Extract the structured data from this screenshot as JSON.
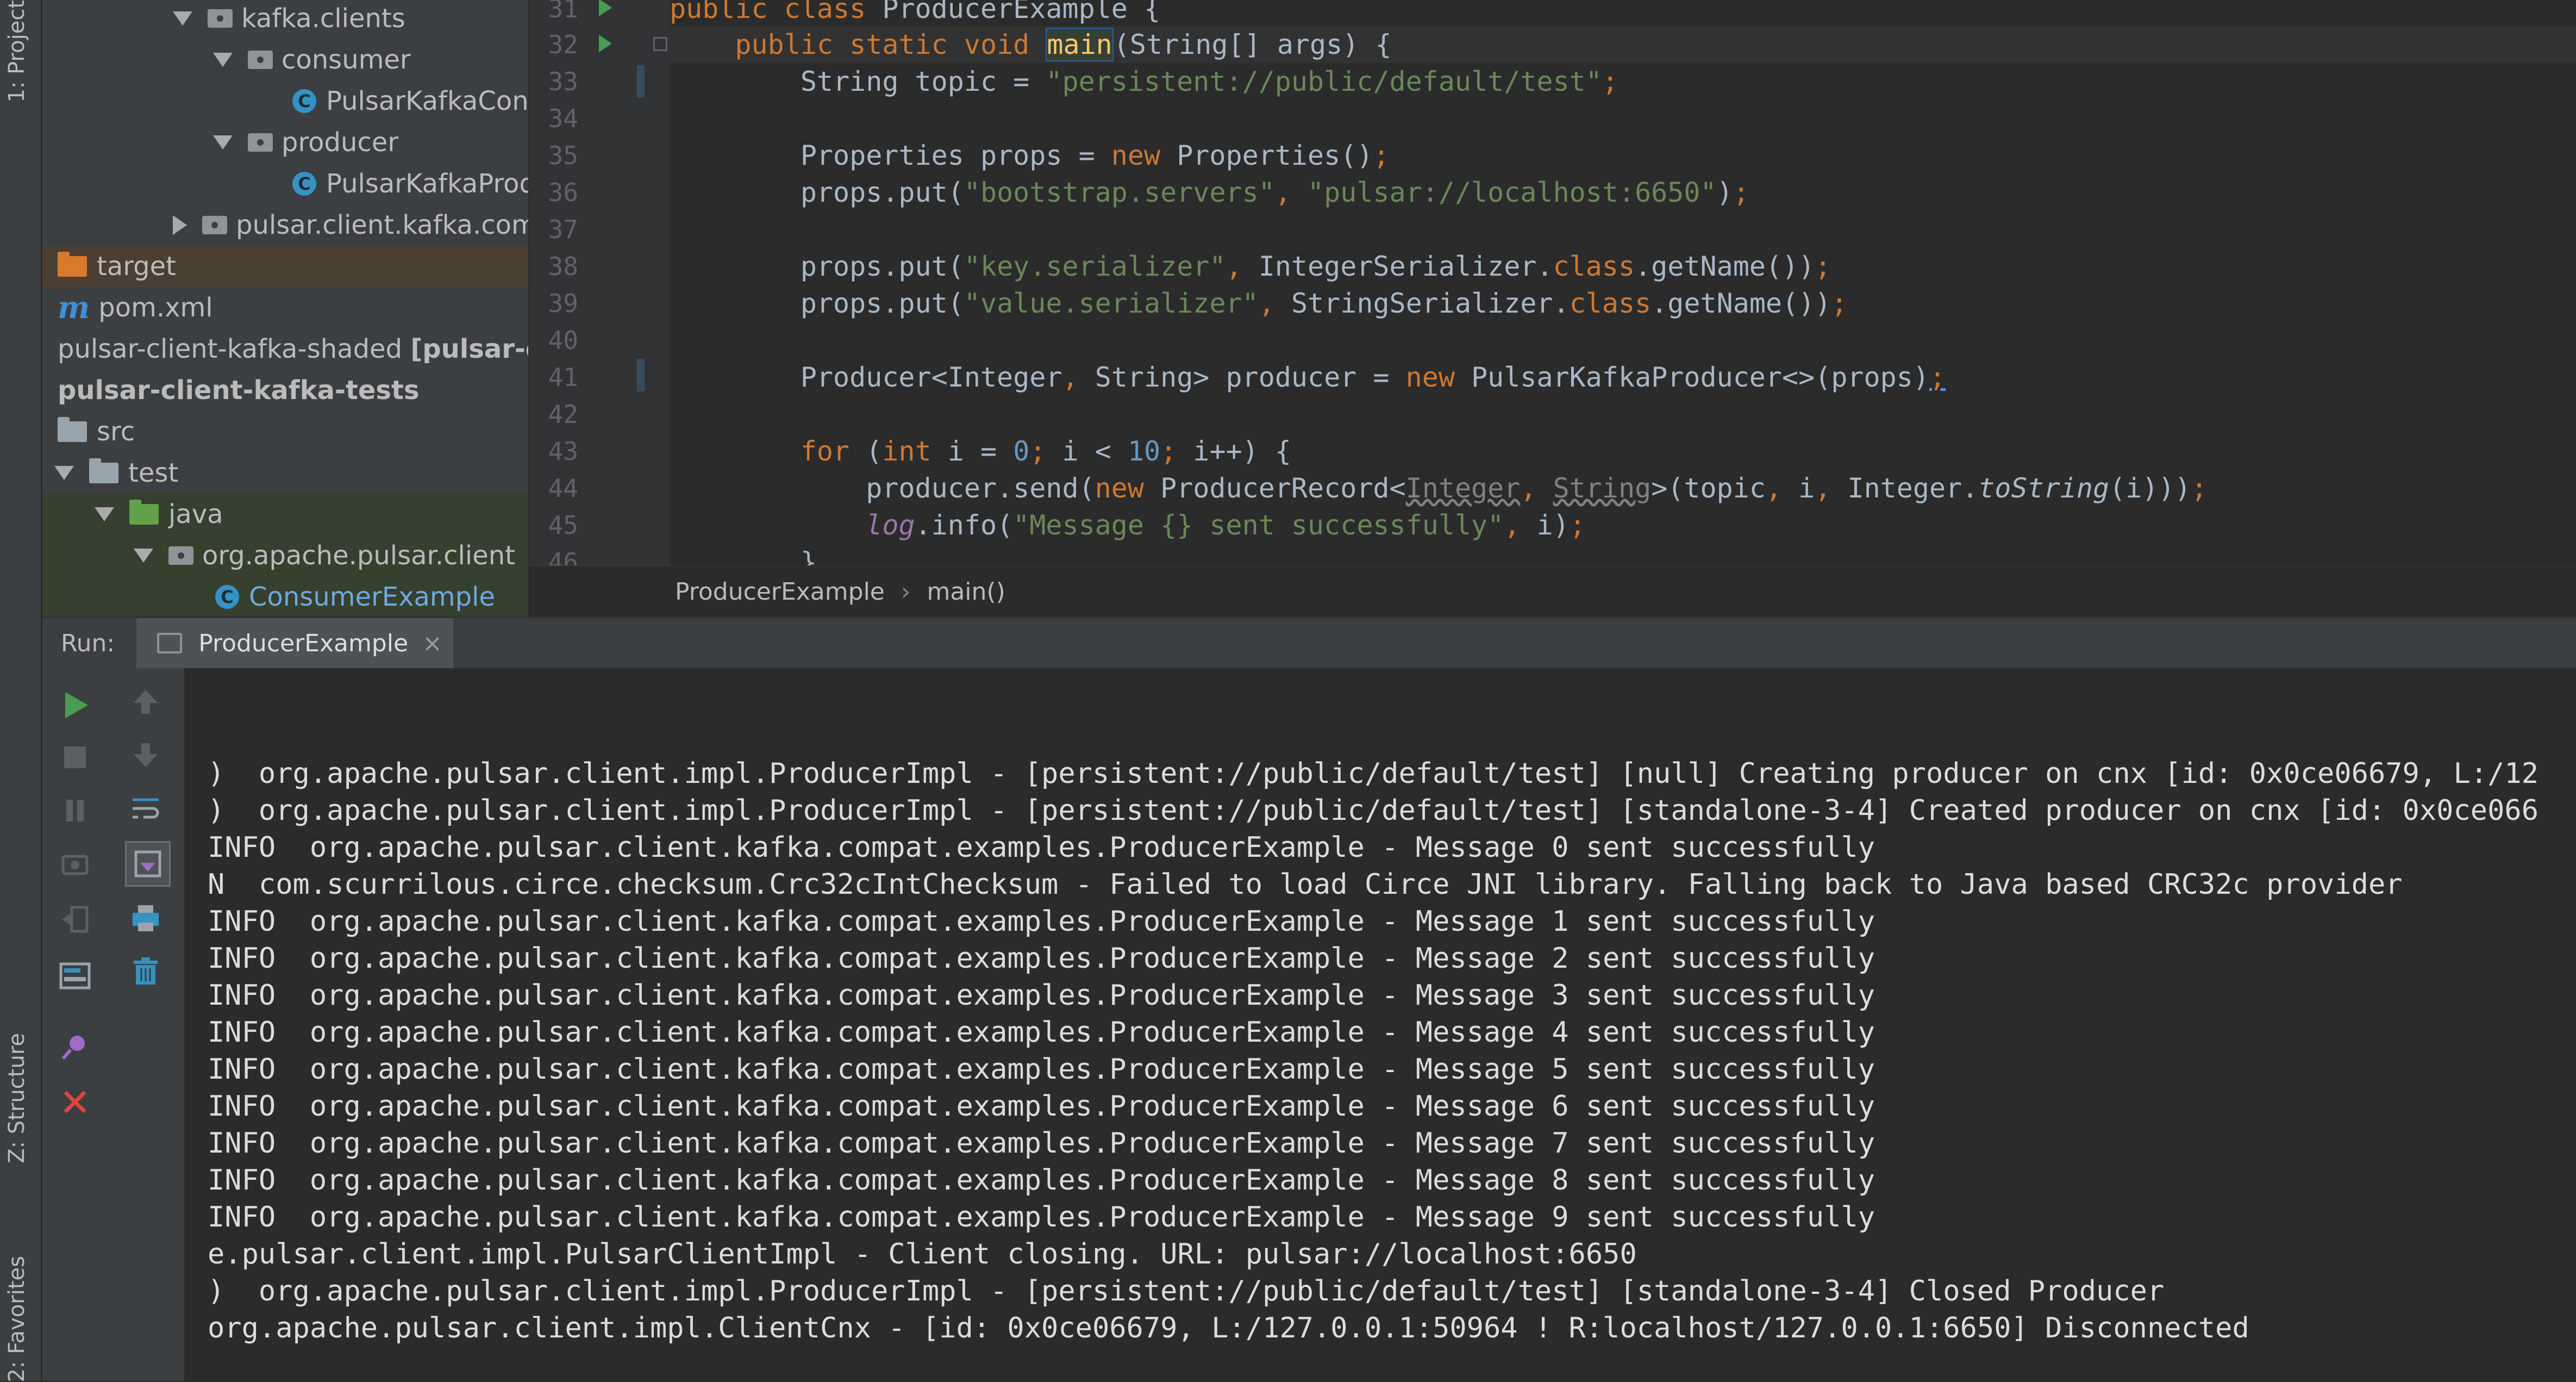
{
  "left_stripe": {
    "project_tab": "1: Project",
    "structure_tab": "Z: Structure",
    "favorites_tab": "2: Favorites"
  },
  "project_tree": {
    "rows": [
      {
        "label": "kafka.clients",
        "icon": "package-icon",
        "expanded": true
      },
      {
        "label": "consumer",
        "icon": "package-icon",
        "expanded": true
      },
      {
        "label": "PulsarKafkaConsumer",
        "icon": "class-icon"
      },
      {
        "label": "producer",
        "icon": "package-icon",
        "expanded": true
      },
      {
        "label": "PulsarKafkaProducer",
        "icon": "class-icon"
      },
      {
        "label": "pulsar.client.kafka.compat",
        "icon": "package-icon",
        "expanded": false
      },
      {
        "label": "target",
        "icon": "folder-orange-icon"
      },
      {
        "label": "pom.xml",
        "icon": "maven-icon"
      },
      {
        "label": "pulsar-client-kafka-shaded",
        "suffix": "[pulsar-client-kafka]",
        "icon": "none"
      },
      {
        "label": "pulsar-client-kafka-tests",
        "icon": "none"
      },
      {
        "label": "src",
        "icon": "folder-icon"
      },
      {
        "label": "test",
        "icon": "folder-icon",
        "expanded": true
      },
      {
        "label": "java",
        "icon": "folder-green-icon",
        "expanded": true
      },
      {
        "label": "org.apache.pulsar.client",
        "icon": "package-icon",
        "expanded": true
      },
      {
        "label": "ConsumerExample",
        "icon": "class-icon"
      }
    ]
  },
  "editor": {
    "line_numbers": [
      "31",
      "32",
      "33",
      "34",
      "35",
      "36",
      "37",
      "38",
      "39",
      "40",
      "41",
      "42",
      "43",
      "44",
      "45",
      "46"
    ],
    "breadcrumb_class": "ProducerExample",
    "breadcrumb_method": "main()",
    "breadcrumb_sep": "›"
  },
  "run_panel": {
    "label": "Run:",
    "tab_title": "ProducerExample",
    "close": "×",
    "log_lines": [
      ")  org.apache.pulsar.client.impl.ProducerImpl - [persistent://public/default/test] [null] Creating producer on cnx [id: 0x0ce06679, L:/12",
      ")  org.apache.pulsar.client.impl.ProducerImpl - [persistent://public/default/test] [standalone-3-4] Created producer on cnx [id: 0x0ce066",
      "INFO  org.apache.pulsar.client.kafka.compat.examples.ProducerExample - Message 0 sent successfully",
      "N  com.scurrilous.circe.checksum.Crc32cIntChecksum - Failed to load Circe JNI library. Falling back to Java based CRC32c provider",
      "INFO  org.apache.pulsar.client.kafka.compat.examples.ProducerExample - Message 1 sent successfully",
      "INFO  org.apache.pulsar.client.kafka.compat.examples.ProducerExample - Message 2 sent successfully",
      "INFO  org.apache.pulsar.client.kafka.compat.examples.ProducerExample - Message 3 sent successfully",
      "INFO  org.apache.pulsar.client.kafka.compat.examples.ProducerExample - Message 4 sent successfully",
      "INFO  org.apache.pulsar.client.kafka.compat.examples.ProducerExample - Message 5 sent successfully",
      "INFO  org.apache.pulsar.client.kafka.compat.examples.ProducerExample - Message 6 sent successfully",
      "INFO  org.apache.pulsar.client.kafka.compat.examples.ProducerExample - Message 7 sent successfully",
      "INFO  org.apache.pulsar.client.kafka.compat.examples.ProducerExample - Message 8 sent successfully",
      "INFO  org.apache.pulsar.client.kafka.compat.examples.ProducerExample - Message 9 sent successfully",
      "e.pulsar.client.impl.PulsarClientImpl - Client closing. URL: pulsar://localhost:6650",
      ")  org.apache.pulsar.client.impl.ProducerImpl - [persistent://public/default/test] [standalone-3-4] Closed Producer",
      "org.apache.pulsar.client.impl.ClientCnx - [id: 0x0ce06679, L:/127.0.0.1:50964 ! R:localhost/127.0.0.1:6650] Disconnected"
    ]
  },
  "colors": {
    "background": "#2b2b2b",
    "panel": "#3c3f41",
    "keyword": "#cc7832",
    "string": "#6a8759",
    "number": "#6897bb",
    "run_green": "#499c54",
    "stop_red": "#e0443e"
  }
}
